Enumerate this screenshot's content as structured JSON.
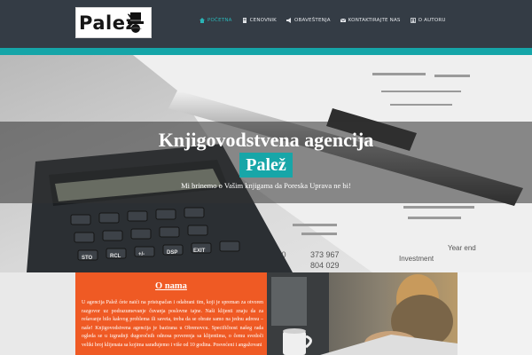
{
  "brand": {
    "name": "Palež",
    "logo_icon": "top-hat-mustache-icon"
  },
  "nav": {
    "items": [
      {
        "label": "POČETNA",
        "icon": "home-icon",
        "active": true
      },
      {
        "label": "CENOVNIK",
        "icon": "document-icon",
        "active": false
      },
      {
        "label": "OBAVEŠTENJA",
        "icon": "megaphone-icon",
        "active": false
      },
      {
        "label": "KONTAKTIRAJTE NAS",
        "icon": "envelope-icon",
        "active": false
      },
      {
        "label": "O AUTORU",
        "icon": "user-icon",
        "active": false
      }
    ]
  },
  "hero": {
    "title": "Knjigovodstvena agencija",
    "badge": "Palež",
    "subtitle": "Mi brinemo o Vašim knjigama da Poreska Uprava ne bi!"
  },
  "about": {
    "title": "O nama",
    "text": "U agencija Palež ćete naići na pristupačan i odabrani tim, koji je spreman za otvoren razgovor uz podrazumevanje čuvanja poslovne tajne. Naši klijenti znaju da za rešavanje bilo kakvog problema ili saveta, treba da se obrate samo na jednu adresu – naše! Knjigovodstvena agencija je bazirana u Obrenovcu. Specifičnost našeg rada ogleda se u izgradnji dugoročnih odnosa poverenja sa klijentima, o čemu svedoči veliki broj klijenata sa kojima sarađujemo i više od 10 godina. Posvećeni i angažovani"
  },
  "colors": {
    "nav_bg": "#343c45",
    "accent": "#15a5a8",
    "orange": "#ef5a24"
  }
}
